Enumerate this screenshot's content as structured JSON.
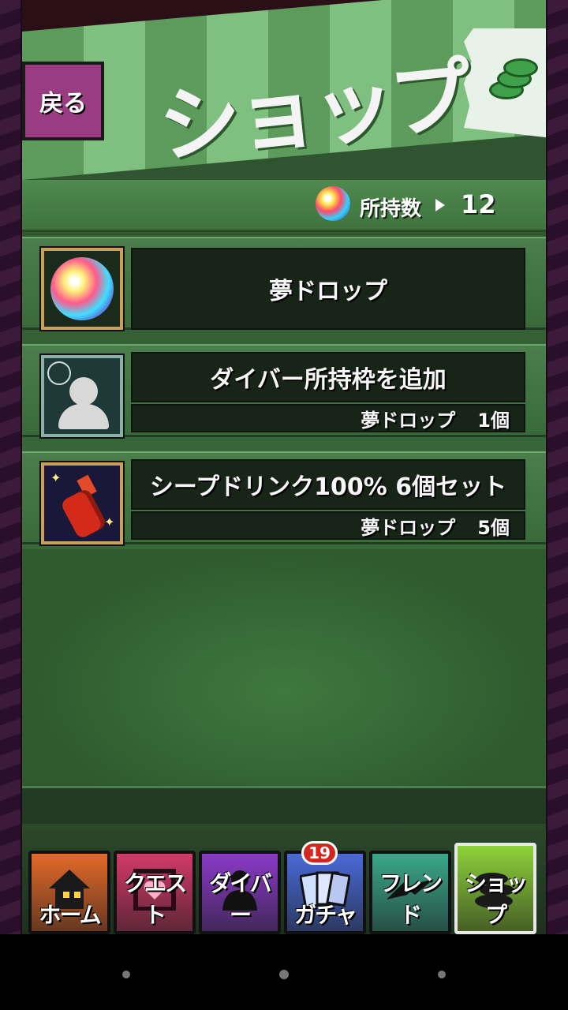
{
  "header": {
    "title": "ショップ",
    "back_label": "戻る"
  },
  "currency": {
    "label": "所持数",
    "value": "12",
    "icon": "dream-drop-orb-icon"
  },
  "items": [
    {
      "name": "夢ドロップ",
      "icon": "dream-drop-orb-icon"
    },
    {
      "name": "ダイバー所持枠を追加",
      "price_currency": "夢ドロップ",
      "price_amount": "1個",
      "icon": "user-slot-icon"
    },
    {
      "name": "シープドリンク100% 6個セット",
      "price_currency": "夢ドロップ",
      "price_amount": "5個",
      "icon": "sheep-drink-bottle-icon"
    }
  ],
  "nav": {
    "tabs": [
      {
        "label": "ホーム",
        "icon": "house-icon",
        "color": "#e46a2a"
      },
      {
        "label": "クエスト",
        "icon": "heart-gate-icon",
        "color": "#d23a6a"
      },
      {
        "label": "ダイバー",
        "icon": "diver-silhouette-icon",
        "color": "#8a3ac8"
      },
      {
        "label": "ガチャ",
        "icon": "cards-icon",
        "color": "#4a6ad8",
        "badge": "19"
      },
      {
        "label": "フレンド",
        "icon": "handshake-icon",
        "color": "#3aa88a"
      },
      {
        "label": "ショップ",
        "icon": "coins-icon",
        "color": "#8fd23a",
        "active": true
      }
    ]
  },
  "colors": {
    "accent_green": "#3fa24a",
    "back_button": "#9a3c82",
    "badge_red": "#d3261f"
  }
}
